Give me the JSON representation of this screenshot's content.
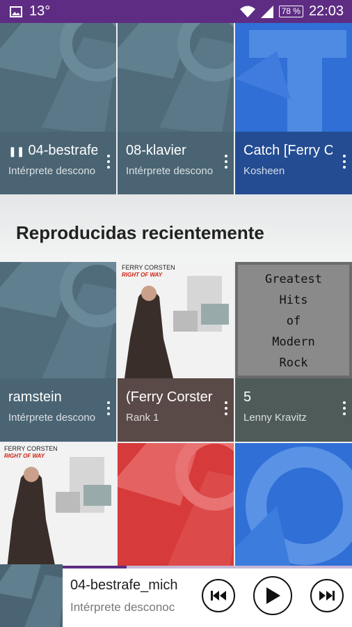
{
  "status_bar": {
    "temperature": "13°",
    "battery": "78 %",
    "time": "22:03"
  },
  "top_row": [
    {
      "title": "04-bestrafe_",
      "subtitle": "Intérprete descono",
      "playing_icon": "pause-icon"
    },
    {
      "title": "08-klavier",
      "subtitle": "Intérprete descono"
    },
    {
      "title": "Catch [Ferry C",
      "subtitle": "Kosheen"
    }
  ],
  "section": {
    "title": "Reproducidas recientemente"
  },
  "recent_row": [
    {
      "title": "ramstein",
      "subtitle": "Intérprete descono",
      "art": "placeholder"
    },
    {
      "title": "(Ferry Corster",
      "subtitle": "Rank 1",
      "art": "cover",
      "cover_brand": "FERRY CORSTEN",
      "cover_script": "RIGHT OF WAY"
    },
    {
      "title": "5",
      "subtitle": "Lenny Kravitz",
      "art": "greatest",
      "cover_lines": [
        "Greatest",
        "Hits",
        "of",
        "Modern",
        "Rock"
      ]
    }
  ],
  "bottom_row": [
    {
      "art": "cover",
      "cover_brand": "FERRY CORSTEN",
      "cover_script": "RIGHT OF WAY"
    },
    {
      "art": "red"
    },
    {
      "art": "blue"
    }
  ],
  "player": {
    "title": "04-bestrafe_mich",
    "subtitle": "Intérprete desconoc",
    "progress": 0.22
  },
  "colors": {
    "status_bar": "#5e2d83",
    "accent": "#5e2d83"
  }
}
